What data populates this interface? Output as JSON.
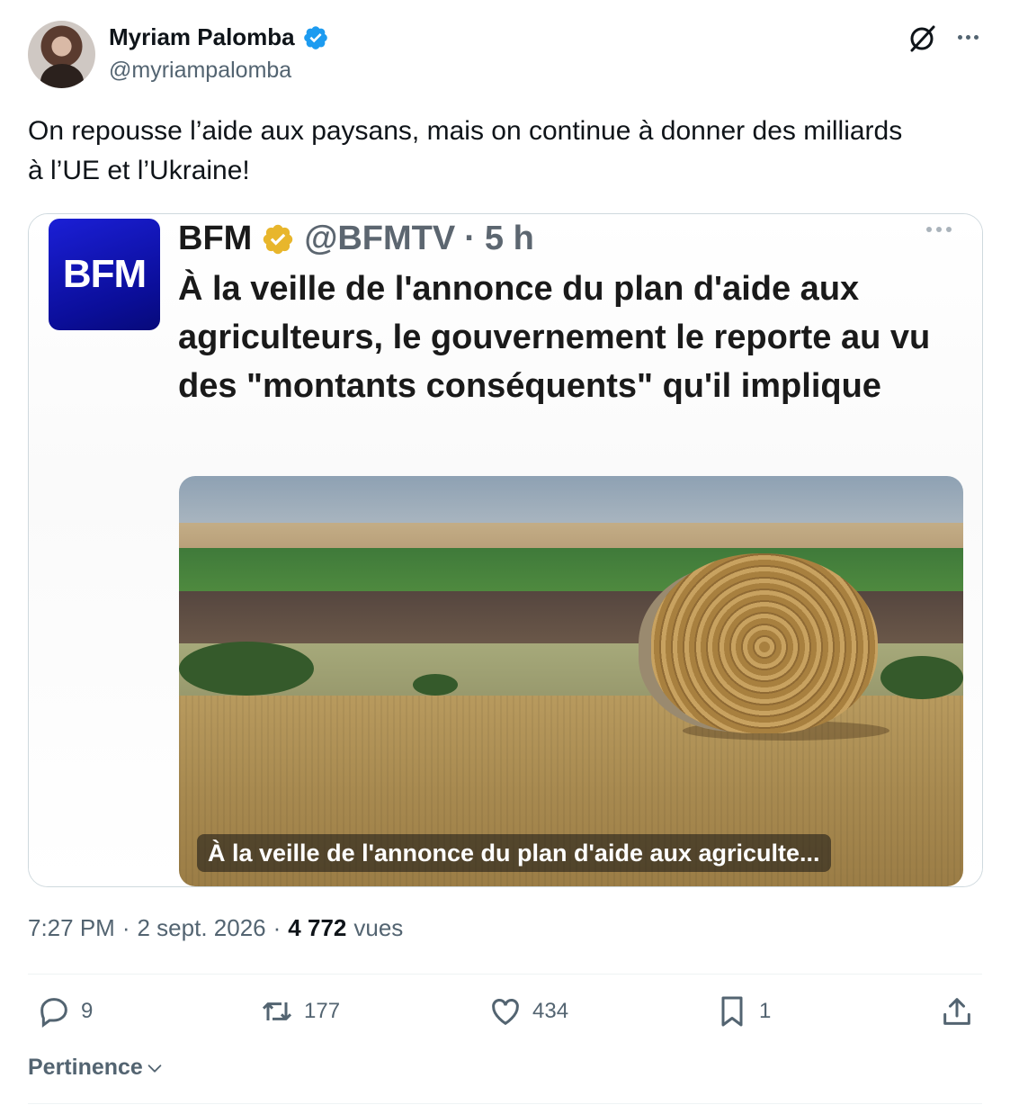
{
  "author": {
    "name": "Myriam Palomba",
    "handle": "@myriampalomba"
  },
  "tweet": {
    "text": "On repousse l’aide aux paysans, mais on continue à donner des milliards\nà l’UE et l’Ukraine!"
  },
  "quote": {
    "logo_text": "BFM",
    "name": "BFM",
    "handle": "@BFMTV",
    "separator": "·",
    "time": "5 h",
    "title": "À la veille de l'annonce du plan d'aide aux agriculteurs, le gouvernement le reporte au vu des \"montants conséquents\" qu'il implique",
    "caption": "À la veille de l'annonce du plan d'aide aux agriculte..."
  },
  "meta": {
    "time": "7:27 PM",
    "dot1": "·",
    "date": "2 sept. 2026",
    "dot2": "·",
    "views_count": "4 772",
    "views_label": "vues"
  },
  "actions": {
    "replies": "9",
    "reposts": "177",
    "likes": "434",
    "bookmarks": "1"
  },
  "sort": {
    "label": "Pertinence"
  },
  "colors": {
    "verified_blue": "#1d9bf0",
    "gold_badge": "#e8b62c",
    "bfm_blue": "#0b0e9a",
    "text_secondary": "#536471"
  }
}
